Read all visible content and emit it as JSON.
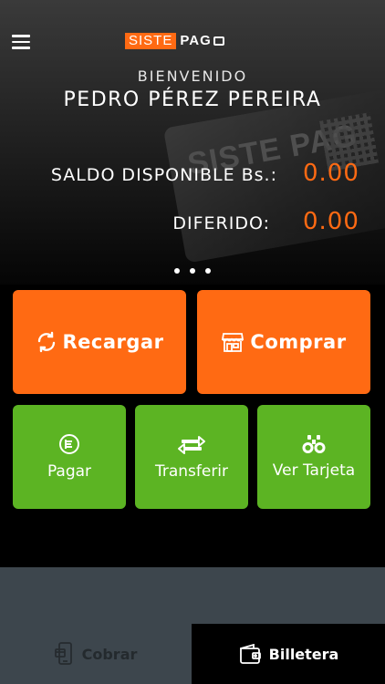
{
  "header": {
    "brand_left": "SISTE",
    "brand_right": "PAG",
    "deco_card_text": "SISTE PAG",
    "welcome": "BIENVENIDO",
    "user_name": "PEDRO PÉREZ PEREIRA"
  },
  "balance": {
    "available_label": "SALDO DISPONIBLE Bs.:",
    "available_value": "0.00",
    "deferred_label": "DIFERIDO:",
    "deferred_value": "0.00"
  },
  "pager": {
    "pages": 3
  },
  "actions": {
    "recargar": {
      "label": "Recargar",
      "icon": "refresh-icon"
    },
    "comprar": {
      "label": "Comprar",
      "icon": "store-icon"
    },
    "pagar": {
      "label": "Pagar",
      "icon": "pay-coin-icon"
    },
    "transferir": {
      "label": "Transferir",
      "icon": "transfer-arrows-icon"
    },
    "ver_tarjeta": {
      "label": "Ver Tarjeta",
      "icon": "binoculars-icon"
    }
  },
  "tabs": {
    "cobrar": {
      "label": "Cobrar",
      "icon": "phone-payment-icon",
      "active": false
    },
    "billetera": {
      "label": "Billetera",
      "icon": "wallet-icon",
      "active": true
    }
  },
  "colors": {
    "accent_orange": "#ff6a13",
    "accent_green": "#5cb423",
    "bottom_bar": "#3d464d",
    "background": "#000000"
  }
}
